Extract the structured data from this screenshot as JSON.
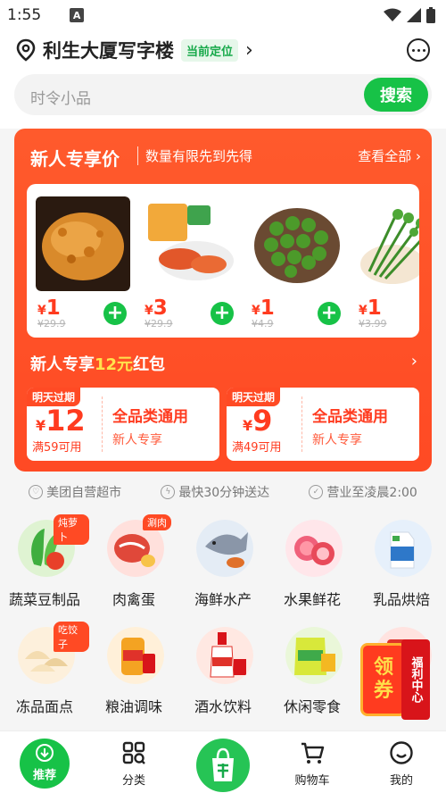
{
  "status": {
    "time": "1:55",
    "icon_badge": "A"
  },
  "header": {
    "location": "利生大厦写字楼",
    "current_badge": "当前定位"
  },
  "search": {
    "placeholder": "时令小品",
    "button": "搜索"
  },
  "promo": {
    "title": "新人专享价",
    "subtitle": "数量有限先到先得",
    "view_all": "查看全部 ›",
    "products": [
      {
        "price": "1",
        "original": "¥29.9",
        "image": "fried-chicken"
      },
      {
        "price": "3",
        "original": "¥29.9",
        "image": "chicken-wings"
      },
      {
        "price": "1",
        "original": "¥4.9",
        "image": "green-limes"
      },
      {
        "price": "1",
        "original": "¥3.99",
        "image": "leafy-greens"
      }
    ],
    "currency": "¥",
    "add_glyph": "+",
    "redpack_prefix": "新人专享",
    "redpack_highlight": "12元",
    "redpack_suffix": "红包",
    "redpack_arrow": "›",
    "coupons": [
      {
        "tag": "明天过期",
        "amount": "12",
        "min": "满59可用",
        "scope": "全品类通用",
        "who": "新人专享"
      },
      {
        "tag": "明天过期",
        "amount": "9",
        "min": "满49可用",
        "scope": "全品类通用",
        "who": "新人专享"
      }
    ]
  },
  "features": [
    {
      "label": "美团自营超市",
      "icon": "heart-shield-icon"
    },
    {
      "label": "最快30分钟送达",
      "icon": "lightning-icon"
    },
    {
      "label": "营业至凌晨2:00",
      "icon": "check-shield-icon"
    }
  ],
  "categories": [
    {
      "label": "蔬菜豆制品",
      "badge": "炖萝卜",
      "color": "#dff3d2",
      "accent": "#3fae3f"
    },
    {
      "label": "肉禽蛋",
      "badge": "涮肉",
      "color": "#ffe0dc",
      "accent": "#e0483a"
    },
    {
      "label": "海鲜水产",
      "badge": "",
      "color": "#e4ecf5",
      "accent": "#8a96a8"
    },
    {
      "label": "水果鲜花",
      "badge": "",
      "color": "#ffe6ea",
      "accent": "#f0607a"
    },
    {
      "label": "乳品烘焙",
      "badge": "",
      "color": "#e6f0fb",
      "accent": "#2e78c9"
    },
    {
      "label": "冻品面点",
      "badge": "吃饺子",
      "color": "#fdf0dc",
      "accent": "#e8c27c"
    },
    {
      "label": "粮油调味",
      "badge": "",
      "color": "#fff0d9",
      "accent": "#f4a322"
    },
    {
      "label": "酒水饮料",
      "badge": "",
      "color": "#ffe8e2",
      "accent": "#e0322a"
    },
    {
      "label": "休闲零食",
      "badge": "",
      "color": "#eaf7d9",
      "accent": "#d8e83a"
    },
    {
      "label": "",
      "badge": "",
      "color": "#ffe3e0",
      "accent": "#e0322a"
    }
  ],
  "coupon_float": {
    "main_line1": "领",
    "main_line2": "券",
    "side": "福利中心"
  },
  "tabbar": [
    {
      "label": "推荐"
    },
    {
      "label": "分类"
    },
    {
      "label": ""
    },
    {
      "label": "购物车"
    },
    {
      "label": "我的"
    }
  ],
  "colors": {
    "brand_green": "#17c247",
    "promo_red": "#ff4a24"
  }
}
